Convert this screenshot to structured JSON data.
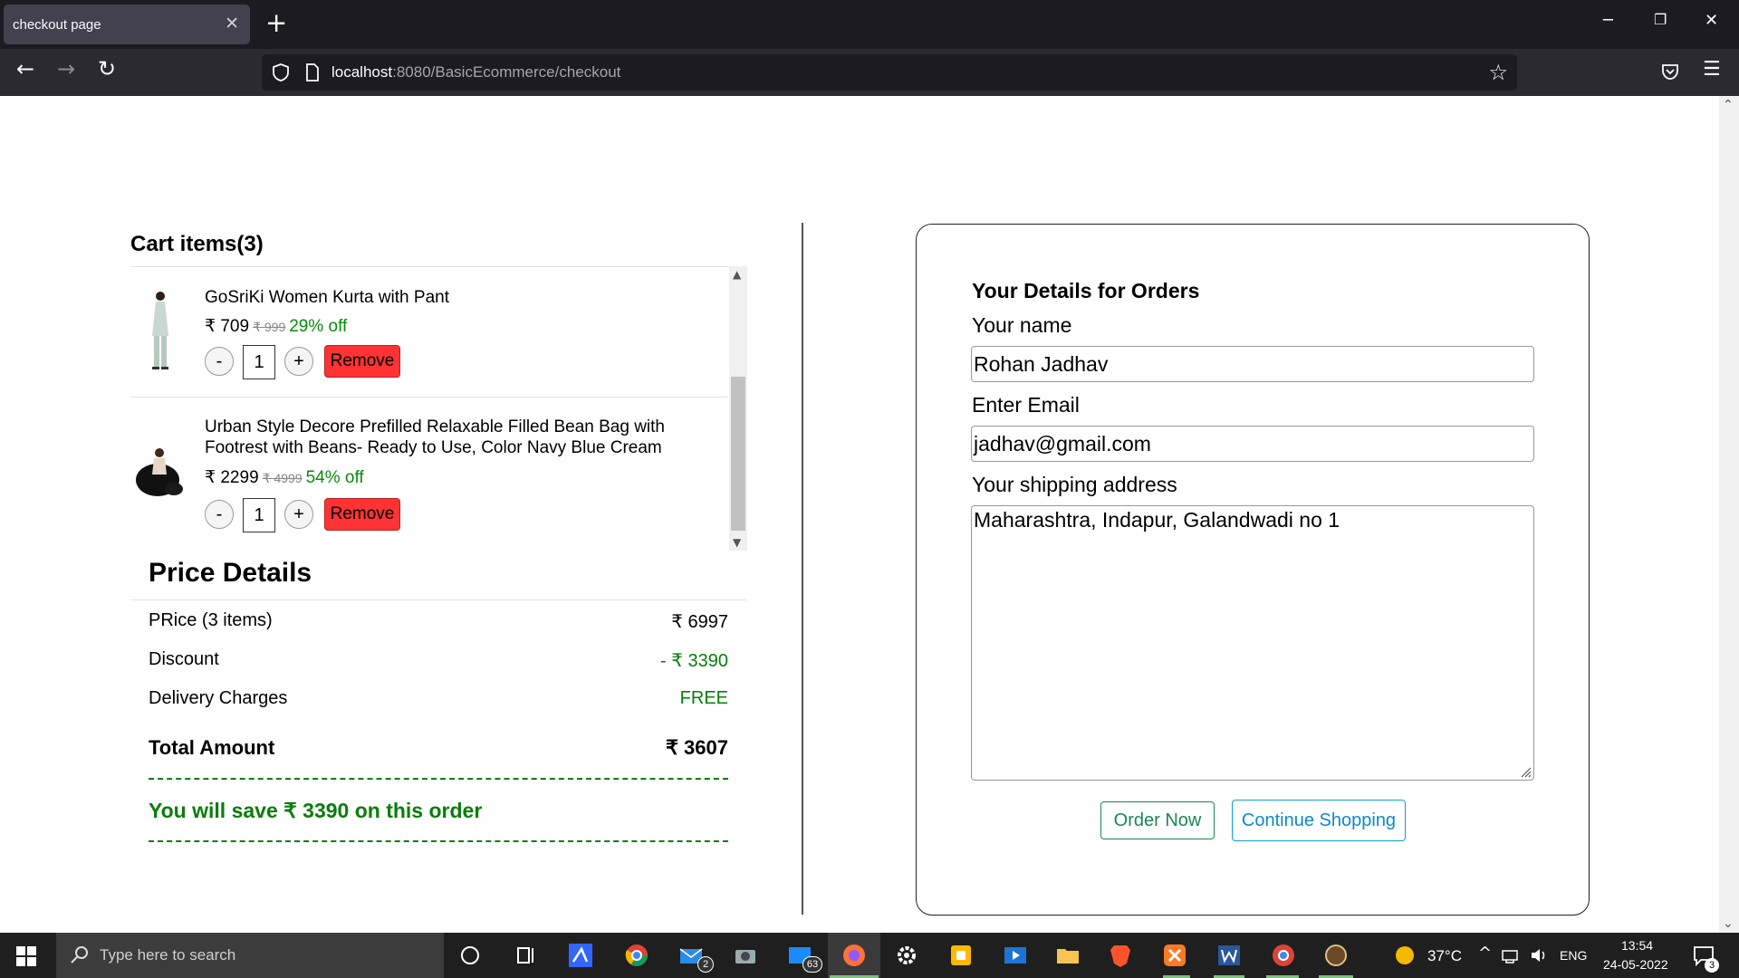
{
  "browser": {
    "tab_title": "checkout page",
    "url_host": "localhost",
    "url_rest": ":8080/BasicEcommerce/checkout"
  },
  "cart": {
    "title": "Cart items(3)",
    "items": [
      {
        "name": "GoSriKi Women Kurta with Pant",
        "price": "₹ 709",
        "original_price": "₹ 999",
        "discount": "29% off",
        "qty": "1",
        "minus": "-",
        "plus": "+",
        "remove_label": "Remove"
      },
      {
        "name": "Urban Style Decore Prefilled Relaxable Filled Bean Bag with Footrest with Beans- Ready to Use, Color Navy Blue Cream",
        "price": "₹ 2299",
        "original_price": "₹ 4999",
        "discount": "54% off",
        "qty": "1",
        "minus": "-",
        "plus": "+",
        "remove_label": "Remove"
      }
    ]
  },
  "price_details": {
    "title": "Price Details",
    "price_label": "PRice (3 items)",
    "price_value": "₹ 6997",
    "discount_label": "Discount",
    "discount_value": "- ₹ 3390",
    "delivery_label": "Delivery Charges",
    "delivery_value": "FREE",
    "total_label": "Total Amount",
    "total_value": "₹ 3607",
    "save_message": "You will save ₹ 3390 on this order"
  },
  "order_form": {
    "title": "Your Details for Orders",
    "name_label": "Your name",
    "name_value": "Rohan Jadhav",
    "email_label": "Enter Email",
    "email_value": "jadhav@gmail.com",
    "address_label": "Your shipping address",
    "address_value": "Maharashtra, Indapur, Galandwadi no 1",
    "order_button": "Order Now",
    "continue_button": "Continue Shopping"
  },
  "taskbar": {
    "search_placeholder": "Type here to search",
    "mail_badge": "2",
    "files_badge": "63",
    "temperature": "37°C",
    "language": "ENG",
    "time": "13:54",
    "date": "24-05-2022",
    "notification_count": "3"
  },
  "colors": {
    "green": "#0a7d0a",
    "remove_red": "#ff3333",
    "order_green": "#198754",
    "continue_blue": "#0d8ac8"
  }
}
